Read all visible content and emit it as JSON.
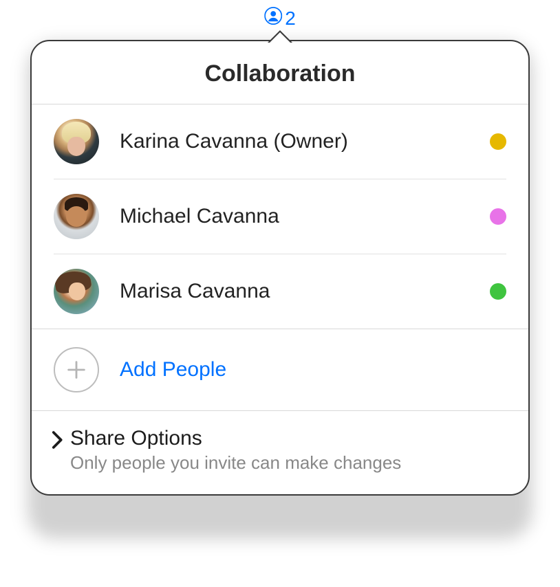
{
  "badge": {
    "count": "2",
    "icon": "person-icon",
    "color": "#0071ff"
  },
  "popover": {
    "title": "Collaboration",
    "participants": [
      {
        "name": "Karina Cavanna (Owner)",
        "status_color": "#e6b800",
        "avatar": "av1"
      },
      {
        "name": "Michael Cavanna",
        "status_color": "#e873e8",
        "avatar": "av2"
      },
      {
        "name": "Marisa Cavanna",
        "status_color": "#3fc43f",
        "avatar": "av3"
      }
    ],
    "add_button": {
      "label": "Add People",
      "icon": "plus-icon",
      "color": "#0071ff",
      "border_color": "#bdbdbd"
    },
    "share_options": {
      "title": "Share Options",
      "subtitle": "Only people you invite can make changes"
    }
  }
}
